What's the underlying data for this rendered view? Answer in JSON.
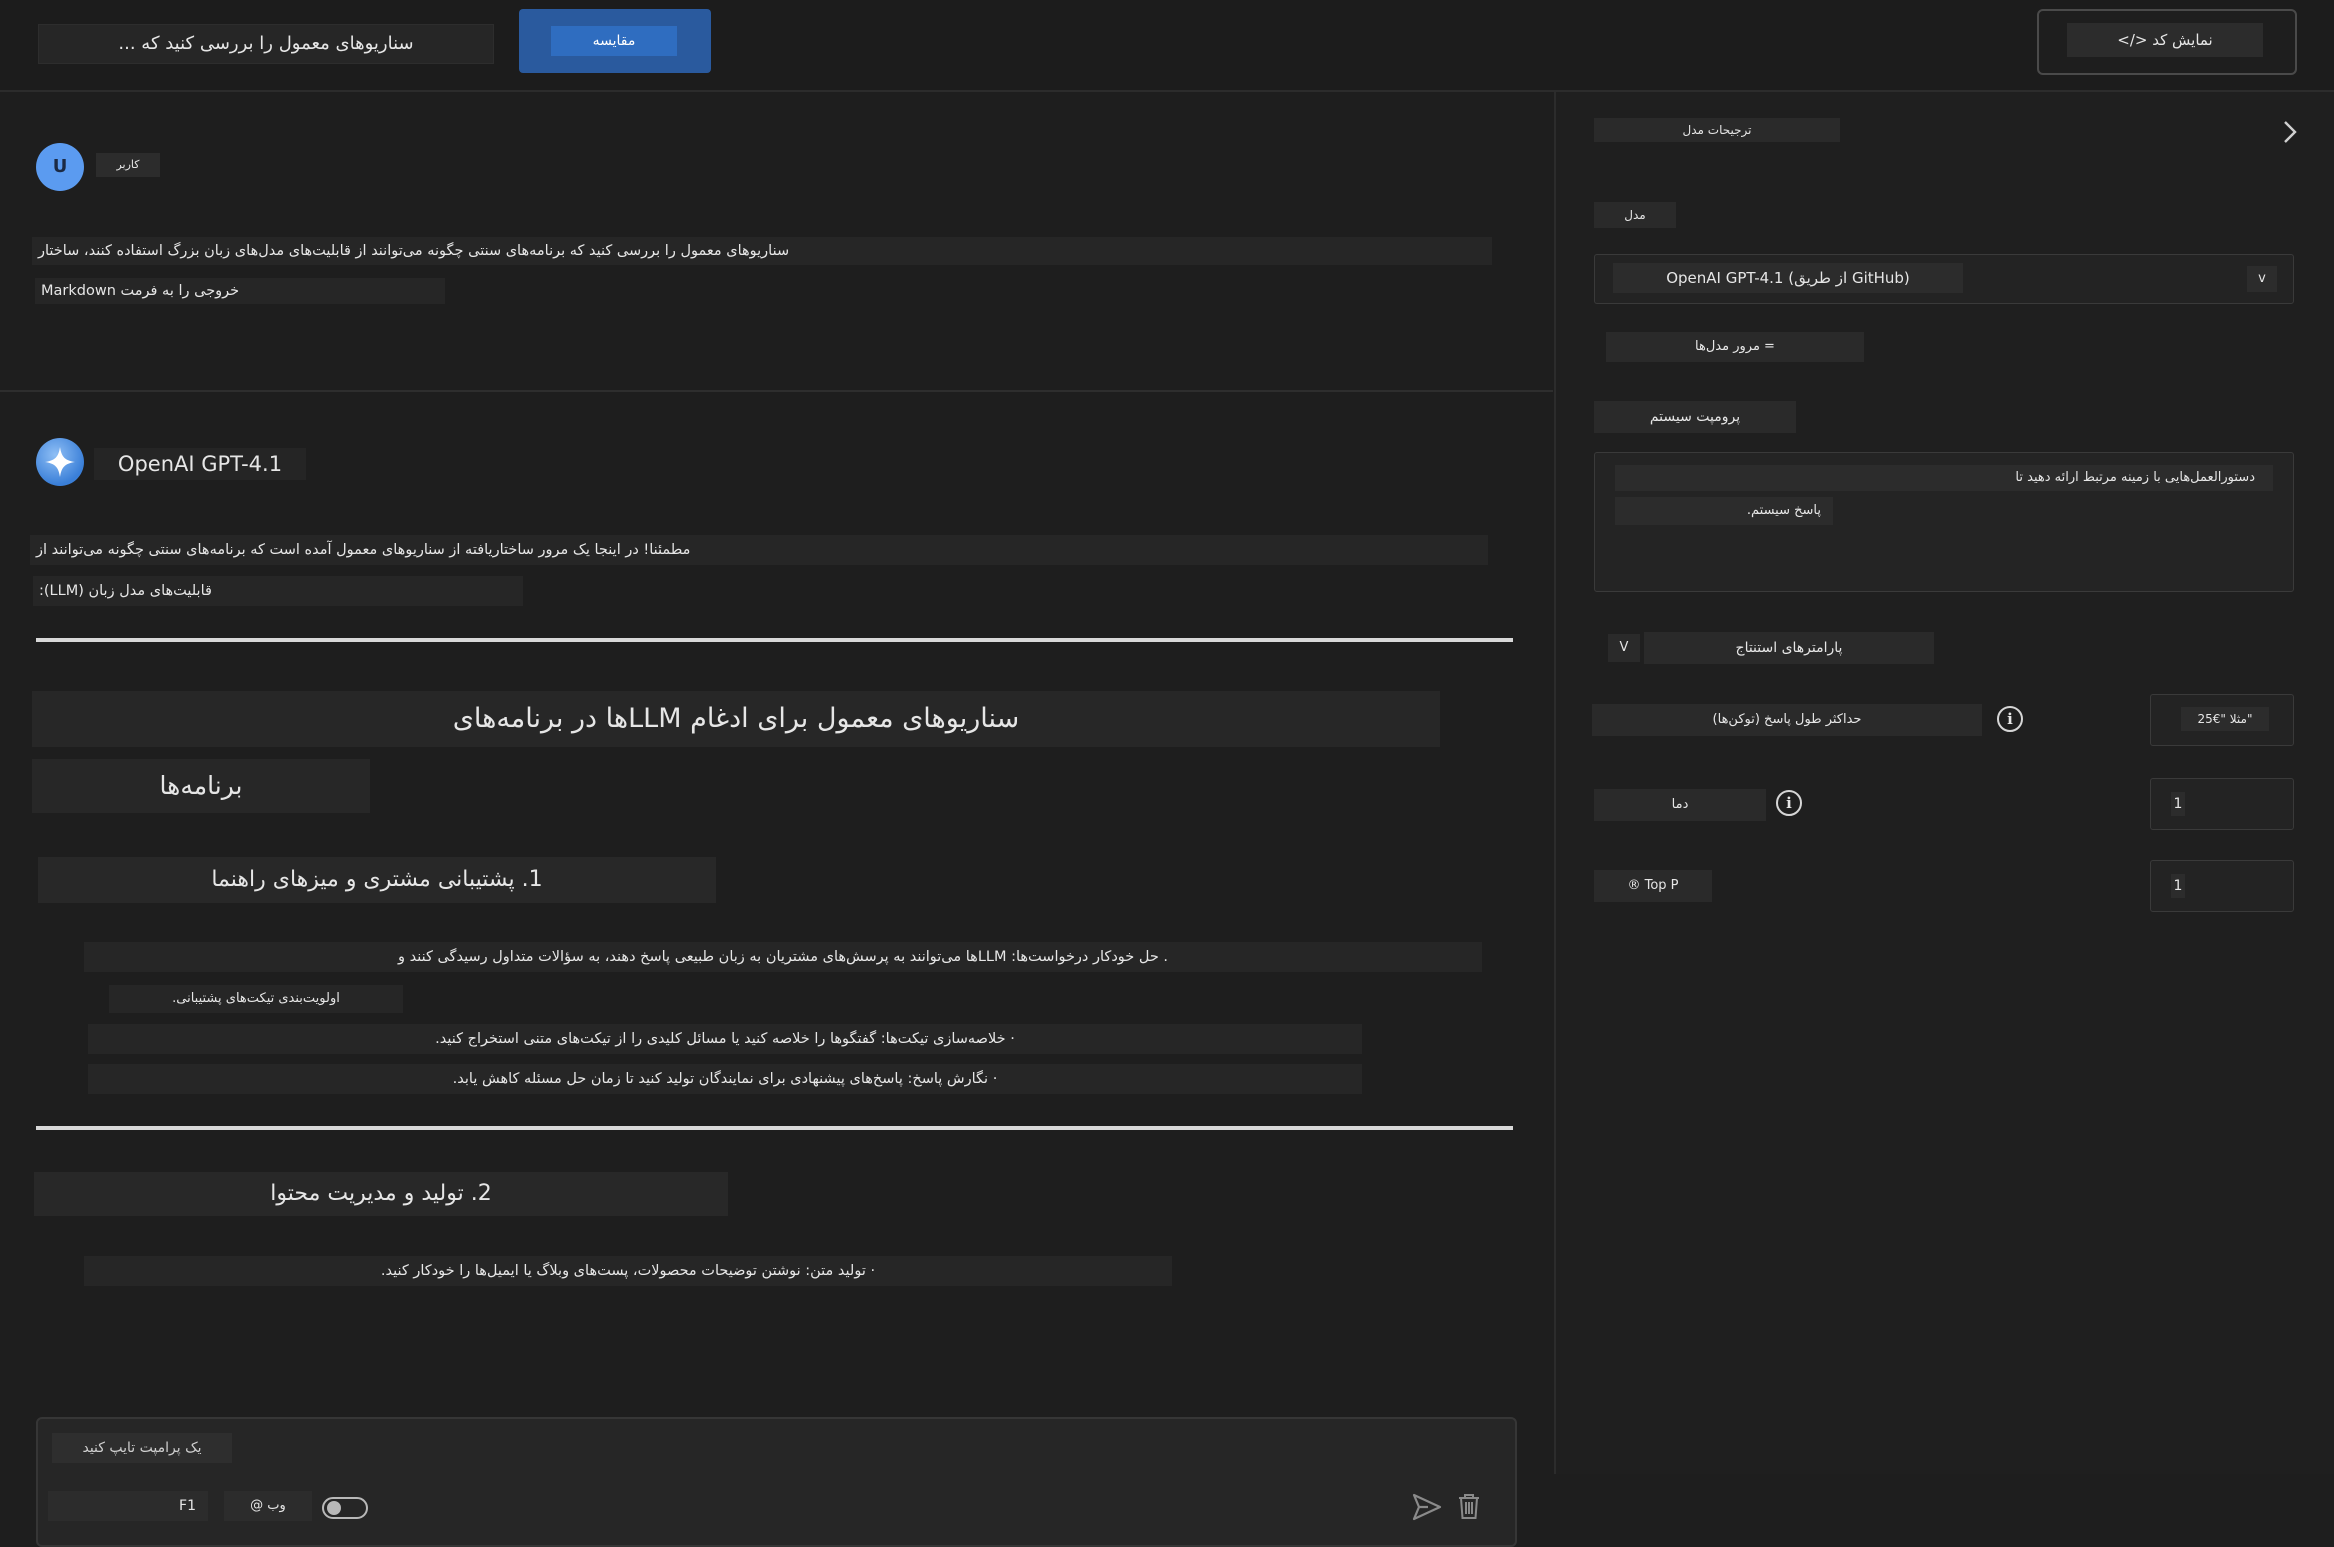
{
  "topbar": {
    "search_text": "سناریوهای معمول را بررسی کنید که ...",
    "compare_label": "مقایسه",
    "view_code_label": "</> نمایش کد"
  },
  "chat": {
    "user": {
      "avatar_letter": "U",
      "label": "کاربر",
      "message_lines": [
        "سناریوهای معمول را بررسی کنید که برنامه‌های سنتی چگونه می‌توانند از قابلیت‌های مدل‌های زبان بزرگ استفاده کنند، ساختار",
        "خروجی را به فرمت Markdown"
      ]
    },
    "assistant": {
      "name": "OpenAI GPT-4.1",
      "intro_lines": [
        "مطمئنا! در اینجا یک مرور ساختاریافته از سناریوهای معمول آمده است که برنامه‌های سنتی چگونه می‌توانند از",
        "قابلیت‌های مدل زبان (LLM):"
      ],
      "heading_main": "سناریوهای معمول برای ادغام LLMها در برنامه‌های",
      "heading_main_cont": "برنامه‌ها",
      "section1_title": "1. پشتیبانی مشتری و میزهای راهنما",
      "section1_bullets": [
        ". حل خودکار درخواست‌ها: LLMها می‌توانند به پرسش‌های مشتریان به زبان طبیعی پاسخ دهند، به سؤالات متداول رسیدگی کنند و",
        "اولویت‌بندی تیکت‌های پشتیبانی.",
        "· خلاصه‌سازی تیکت‌ها: گفتگوها را خلاصه کنید یا مسائل کلیدی را از تیکت‌های متنی استخراج کنید.",
        "· نگارش پاسخ: پاسخ‌های پیشنهادی برای نمایندگان تولید کنید تا زمان حل مسئله کاهش یابد."
      ],
      "section2_title": "2. تولید و مدیریت محتوا",
      "section2_bullets": [
        "· تولید متن: نوشتن توضیحات محصولات، پست‌های وبلاگ یا ایمیل‌ها را خودکار کنید."
      ]
    },
    "input": {
      "placeholder": "یک پرامپت تایپ کنید",
      "shortcut": "F1",
      "web_label": "@ وب"
    }
  },
  "panel": {
    "title": "ترجیحات مدل",
    "model_label": "مدل",
    "model_value": "OpenAI GPT-4.1 (از طریق GitHub)",
    "model_chevron": "v",
    "browse_models": "= مرور مدل‌ها",
    "system_prompt_label": "پرومپت سیستم",
    "system_prompt_lines": [
      "دستورالعمل‌هایی با زمینه مرتبط ارائه دهید تا",
      "پاسخ سیستم."
    ],
    "inference_label": "پارامترهای استنتاج",
    "inference_toggle": "V",
    "max_tokens_label": "حداکثر طول پاسخ (توکن‌ها)",
    "max_tokens_placeholder": "مثلا \"€25\"",
    "temperature_label": "دما",
    "temperature_value": "1",
    "top_p_label": "Top P ®",
    "top_p_value": "1",
    "info_glyph": "i"
  }
}
